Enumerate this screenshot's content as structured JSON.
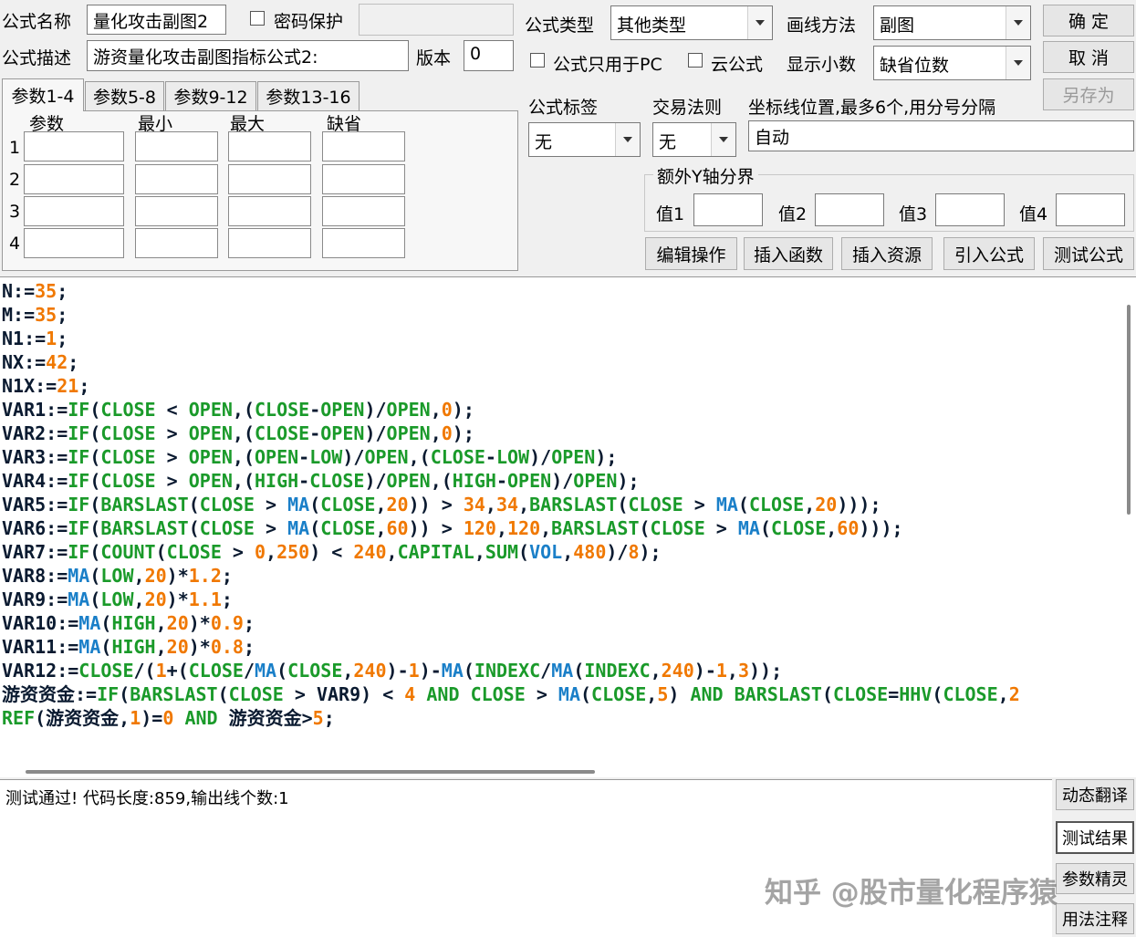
{
  "form": {
    "name_label": "公式名称",
    "name_value": "量化攻击副图2",
    "password_label": "密码保护",
    "password_value": "",
    "desc_label": "公式描述",
    "desc_value": "游资量化攻击副图指标公式2:",
    "version_label": "版本",
    "version_value": "0",
    "type_label": "公式类型",
    "type_value": "其他类型",
    "draw_label": "画线方法",
    "draw_value": "副图",
    "pc_only_label": "公式只用于PC",
    "cloud_label": "云公式",
    "decimals_label": "显示小数",
    "decimals_value": "缺省位数",
    "tag_label": "公式标签",
    "tag_value": "无",
    "trade_label": "交易法则",
    "trade_value": "无",
    "axis_label": "坐标线位置,最多6个,用分号分隔",
    "axis_value": "自动",
    "extra_y_label": "额外Y轴分界",
    "val1_label": "值1",
    "val2_label": "值2",
    "val3_label": "值3",
    "val4_label": "值4"
  },
  "buttons": {
    "ok": "确  定",
    "cancel": "取  消",
    "save_as": "另存为",
    "edit": "编辑操作",
    "insert_func": "插入函数",
    "insert_res": "插入资源",
    "import": "引入公式",
    "test": "测试公式"
  },
  "params": {
    "tabs": [
      "参数1-4",
      "参数5-8",
      "参数9-12",
      "参数13-16"
    ],
    "headers": [
      "参数",
      "最小",
      "最大",
      "缺省"
    ],
    "rows": [
      "1",
      "2",
      "3",
      "4"
    ]
  },
  "code_lines": [
    [
      [
        "N:=",
        "i"
      ],
      [
        "35",
        "n"
      ],
      [
        ";",
        "i"
      ]
    ],
    [
      [
        "M:=",
        "i"
      ],
      [
        "35",
        "n"
      ],
      [
        ";",
        "i"
      ]
    ],
    [
      [
        "N1:=",
        "i"
      ],
      [
        "1",
        "n"
      ],
      [
        ";",
        "i"
      ]
    ],
    [
      [
        "NX:=",
        "i"
      ],
      [
        "42",
        "n"
      ],
      [
        ";",
        "i"
      ]
    ],
    [
      [
        "N1X:=",
        "i"
      ],
      [
        "21",
        "n"
      ],
      [
        ";",
        "i"
      ]
    ],
    [
      [
        "VAR1:=",
        "i"
      ],
      [
        "IF",
        "f"
      ],
      [
        "(",
        "i"
      ],
      [
        "CLOSE",
        "f"
      ],
      [
        " < ",
        "i"
      ],
      [
        "OPEN",
        "f"
      ],
      [
        ",(",
        "i"
      ],
      [
        "CLOSE",
        "f"
      ],
      [
        "-",
        "i"
      ],
      [
        "OPEN",
        "f"
      ],
      [
        ")/",
        "i"
      ],
      [
        "OPEN",
        "f"
      ],
      [
        ",",
        "i"
      ],
      [
        "0",
        "n"
      ],
      [
        ");",
        "i"
      ]
    ],
    [
      [
        "VAR2:=",
        "i"
      ],
      [
        "IF",
        "f"
      ],
      [
        "(",
        "i"
      ],
      [
        "CLOSE",
        "f"
      ],
      [
        " > ",
        "i"
      ],
      [
        "OPEN",
        "f"
      ],
      [
        ",(",
        "i"
      ],
      [
        "CLOSE",
        "f"
      ],
      [
        "-",
        "i"
      ],
      [
        "OPEN",
        "f"
      ],
      [
        ")/",
        "i"
      ],
      [
        "OPEN",
        "f"
      ],
      [
        ",",
        "i"
      ],
      [
        "0",
        "n"
      ],
      [
        ");",
        "i"
      ]
    ],
    [
      [
        "VAR3:=",
        "i"
      ],
      [
        "IF",
        "f"
      ],
      [
        "(",
        "i"
      ],
      [
        "CLOSE",
        "f"
      ],
      [
        " > ",
        "i"
      ],
      [
        "OPEN",
        "f"
      ],
      [
        ",(",
        "i"
      ],
      [
        "OPEN",
        "f"
      ],
      [
        "-",
        "i"
      ],
      [
        "LOW",
        "f"
      ],
      [
        ")/",
        "i"
      ],
      [
        "OPEN",
        "f"
      ],
      [
        ",(",
        "i"
      ],
      [
        "CLOSE",
        "f"
      ],
      [
        "-",
        "i"
      ],
      [
        "LOW",
        "f"
      ],
      [
        ")/",
        "i"
      ],
      [
        "OPEN",
        "f"
      ],
      [
        ");",
        "i"
      ]
    ],
    [
      [
        "VAR4:=",
        "i"
      ],
      [
        "IF",
        "f"
      ],
      [
        "(",
        "i"
      ],
      [
        "CLOSE",
        "f"
      ],
      [
        " > ",
        "i"
      ],
      [
        "OPEN",
        "f"
      ],
      [
        ",(",
        "i"
      ],
      [
        "HIGH",
        "f"
      ],
      [
        "-",
        "i"
      ],
      [
        "CLOSE",
        "f"
      ],
      [
        ")/",
        "i"
      ],
      [
        "OPEN",
        "f"
      ],
      [
        ",(",
        "i"
      ],
      [
        "HIGH",
        "f"
      ],
      [
        "-",
        "i"
      ],
      [
        "OPEN",
        "f"
      ],
      [
        ")/",
        "i"
      ],
      [
        "OPEN",
        "f"
      ],
      [
        ");",
        "i"
      ]
    ],
    [
      [
        "VAR5:=",
        "i"
      ],
      [
        "IF",
        "f"
      ],
      [
        "(",
        "i"
      ],
      [
        "BARSLAST",
        "f"
      ],
      [
        "(",
        "i"
      ],
      [
        "CLOSE",
        "f"
      ],
      [
        " > ",
        "i"
      ],
      [
        "MA",
        "m"
      ],
      [
        "(",
        "i"
      ],
      [
        "CLOSE",
        "f"
      ],
      [
        ",",
        "i"
      ],
      [
        "20",
        "n"
      ],
      [
        ")) > ",
        "i"
      ],
      [
        "34",
        "n"
      ],
      [
        ",",
        "i"
      ],
      [
        "34",
        "n"
      ],
      [
        ",",
        "i"
      ],
      [
        "BARSLAST",
        "f"
      ],
      [
        "(",
        "i"
      ],
      [
        "CLOSE",
        "f"
      ],
      [
        " > ",
        "i"
      ],
      [
        "MA",
        "m"
      ],
      [
        "(",
        "i"
      ],
      [
        "CLOSE",
        "f"
      ],
      [
        ",",
        "i"
      ],
      [
        "20",
        "n"
      ],
      [
        ")));",
        "i"
      ]
    ],
    [
      [
        "VAR6:=",
        "i"
      ],
      [
        "IF",
        "f"
      ],
      [
        "(",
        "i"
      ],
      [
        "BARSLAST",
        "f"
      ],
      [
        "(",
        "i"
      ],
      [
        "CLOSE",
        "f"
      ],
      [
        " > ",
        "i"
      ],
      [
        "MA",
        "m"
      ],
      [
        "(",
        "i"
      ],
      [
        "CLOSE",
        "f"
      ],
      [
        ",",
        "i"
      ],
      [
        "60",
        "n"
      ],
      [
        ")) > ",
        "i"
      ],
      [
        "120",
        "n"
      ],
      [
        ",",
        "i"
      ],
      [
        "120",
        "n"
      ],
      [
        ",",
        "i"
      ],
      [
        "BARSLAST",
        "f"
      ],
      [
        "(",
        "i"
      ],
      [
        "CLOSE",
        "f"
      ],
      [
        " > ",
        "i"
      ],
      [
        "MA",
        "m"
      ],
      [
        "(",
        "i"
      ],
      [
        "CLOSE",
        "f"
      ],
      [
        ",",
        "i"
      ],
      [
        "60",
        "n"
      ],
      [
        ")));",
        "i"
      ]
    ],
    [
      [
        "VAR7:=",
        "i"
      ],
      [
        "IF",
        "f"
      ],
      [
        "(",
        "i"
      ],
      [
        "COUNT",
        "f"
      ],
      [
        "(",
        "i"
      ],
      [
        "CLOSE",
        "f"
      ],
      [
        " > ",
        "i"
      ],
      [
        "0",
        "n"
      ],
      [
        ",",
        "i"
      ],
      [
        "250",
        "n"
      ],
      [
        ") < ",
        "i"
      ],
      [
        "240",
        "n"
      ],
      [
        ",",
        "i"
      ],
      [
        "CAPITAL",
        "f"
      ],
      [
        ",",
        "i"
      ],
      [
        "SUM",
        "f"
      ],
      [
        "(",
        "i"
      ],
      [
        "VOL",
        "m"
      ],
      [
        ",",
        "i"
      ],
      [
        "480",
        "n"
      ],
      [
        ")/",
        "i"
      ],
      [
        "8",
        "n"
      ],
      [
        ");",
        "i"
      ]
    ],
    [
      [
        "VAR8:=",
        "i"
      ],
      [
        "MA",
        "m"
      ],
      [
        "(",
        "i"
      ],
      [
        "LOW",
        "f"
      ],
      [
        ",",
        "i"
      ],
      [
        "20",
        "n"
      ],
      [
        ")*",
        "i"
      ],
      [
        "1.2",
        "n"
      ],
      [
        ";",
        "i"
      ]
    ],
    [
      [
        "VAR9:=",
        "i"
      ],
      [
        "MA",
        "m"
      ],
      [
        "(",
        "i"
      ],
      [
        "LOW",
        "f"
      ],
      [
        ",",
        "i"
      ],
      [
        "20",
        "n"
      ],
      [
        ")*",
        "i"
      ],
      [
        "1.1",
        "n"
      ],
      [
        ";",
        "i"
      ]
    ],
    [
      [
        "VAR10:=",
        "i"
      ],
      [
        "MA",
        "m"
      ],
      [
        "(",
        "i"
      ],
      [
        "HIGH",
        "f"
      ],
      [
        ",",
        "i"
      ],
      [
        "20",
        "n"
      ],
      [
        ")*",
        "i"
      ],
      [
        "0.9",
        "n"
      ],
      [
        ";",
        "i"
      ]
    ],
    [
      [
        "VAR11:=",
        "i"
      ],
      [
        "MA",
        "m"
      ],
      [
        "(",
        "i"
      ],
      [
        "HIGH",
        "f"
      ],
      [
        ",",
        "i"
      ],
      [
        "20",
        "n"
      ],
      [
        ")*",
        "i"
      ],
      [
        "0.8",
        "n"
      ],
      [
        ";",
        "i"
      ]
    ],
    [
      [
        "VAR12:=",
        "i"
      ],
      [
        "CLOSE",
        "f"
      ],
      [
        "/(",
        "i"
      ],
      [
        "1",
        "n"
      ],
      [
        "+(",
        "i"
      ],
      [
        "CLOSE",
        "f"
      ],
      [
        "/",
        "i"
      ],
      [
        "MA",
        "m"
      ],
      [
        "(",
        "i"
      ],
      [
        "CLOSE",
        "f"
      ],
      [
        ",",
        "i"
      ],
      [
        "240",
        "n"
      ],
      [
        ")-",
        "i"
      ],
      [
        "1",
        "n"
      ],
      [
        ")-",
        "i"
      ],
      [
        "MA",
        "m"
      ],
      [
        "(",
        "i"
      ],
      [
        "INDEXC",
        "f"
      ],
      [
        "/",
        "i"
      ],
      [
        "MA",
        "m"
      ],
      [
        "(",
        "i"
      ],
      [
        "INDEXC",
        "f"
      ],
      [
        ",",
        "i"
      ],
      [
        "240",
        "n"
      ],
      [
        ")-",
        "i"
      ],
      [
        "1",
        "n"
      ],
      [
        ",",
        "i"
      ],
      [
        "3",
        "n"
      ],
      [
        "));",
        "i"
      ]
    ],
    [
      [
        "游资资金",
        "i"
      ],
      [
        ":=",
        "i"
      ],
      [
        "IF",
        "f"
      ],
      [
        "(",
        "i"
      ],
      [
        "BARSLAST",
        "f"
      ],
      [
        "(",
        "i"
      ],
      [
        "CLOSE",
        "f"
      ],
      [
        " > ",
        "i"
      ],
      [
        "VAR9",
        "i"
      ],
      [
        ") < ",
        "i"
      ],
      [
        "4",
        "n"
      ],
      [
        " AND ",
        "f"
      ],
      [
        "CLOSE",
        "f"
      ],
      [
        " > ",
        "i"
      ],
      [
        "MA",
        "m"
      ],
      [
        "(",
        "i"
      ],
      [
        "CLOSE",
        "f"
      ],
      [
        ",",
        "i"
      ],
      [
        "5",
        "n"
      ],
      [
        ") ",
        "i"
      ],
      [
        "AND",
        "f"
      ],
      [
        " ",
        "i"
      ],
      [
        "BARSLAST",
        "f"
      ],
      [
        "(",
        "i"
      ],
      [
        "CLOSE",
        "f"
      ],
      [
        "=",
        "i"
      ],
      [
        "HHV",
        "f"
      ],
      [
        "(",
        "i"
      ],
      [
        "CLOSE",
        "f"
      ],
      [
        ",",
        "i"
      ],
      [
        "2",
        "n"
      ]
    ],
    [
      [
        "REF",
        "f"
      ],
      [
        "(",
        "i"
      ],
      [
        "游资资金",
        "i"
      ],
      [
        ",",
        "i"
      ],
      [
        "1",
        "n"
      ],
      [
        ")=",
        "i"
      ],
      [
        "0",
        "n"
      ],
      [
        " AND ",
        "f"
      ],
      [
        "游资资金",
        "i"
      ],
      [
        ">",
        "i"
      ],
      [
        "5",
        "n"
      ],
      [
        ";",
        "i"
      ]
    ]
  ],
  "output": {
    "text": "测试通过! 代码长度:859,输出线个数:1"
  },
  "side_buttons": [
    "动态翻译",
    "测试结果",
    "参数精灵",
    "用法注释"
  ],
  "watermark": "知乎 @股市量化程序猿",
  "colors": {
    "ident": "#0a1a30",
    "func": "#1a9a2a",
    "number": "#f07800",
    "ma": "#1a7fc8"
  }
}
